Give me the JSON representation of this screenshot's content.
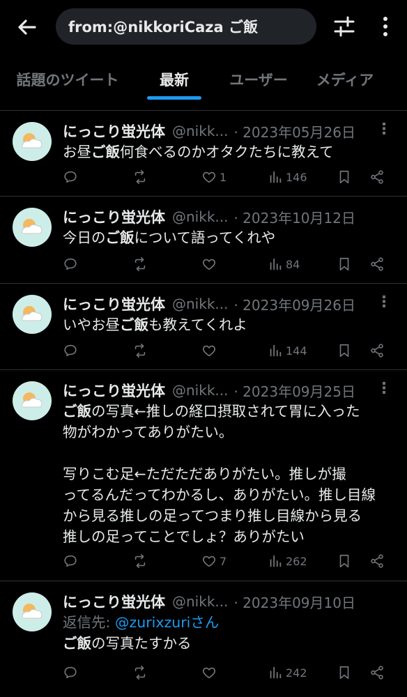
{
  "header": {
    "search_value": "from:@nikkoriCaza ご飯"
  },
  "tabs": [
    {
      "label": "話題のツイート",
      "active": false
    },
    {
      "label": "最新",
      "active": true
    },
    {
      "label": "ユーザー",
      "active": false
    },
    {
      "label": "メディア",
      "active": false
    }
  ],
  "tweets": [
    {
      "name": "にっこり蛍光体",
      "handle": "@nikk...",
      "date": "· 2023年05月26日",
      "body_pre": "お昼",
      "body_hl": "ご飯",
      "body_post": "何食べるのかオタクたちに教えて",
      "replies": "",
      "retweets": "",
      "likes": "1",
      "views": "146"
    },
    {
      "name": "にっこり蛍光体",
      "handle": "@nikk...",
      "date": "· 2023年10月12日",
      "body_pre": "今日の",
      "body_hl": "ご飯",
      "body_post": "について語ってくれや",
      "likes": "",
      "views": "84"
    },
    {
      "name": "にっこり蛍光体",
      "handle": "@nikk...",
      "date": "· 2023年09月26日",
      "body_pre": "いやお昼",
      "body_hl": "ご飯",
      "body_post": "も教えてくれよ",
      "likes": "",
      "views": "144"
    },
    {
      "name": "にっこり蛍光体",
      "handle": "@nikk...",
      "date": "· 2023年09月25日",
      "body_hl": "ご飯",
      "body_line1_post": "の写真←推しの経口摂取されて胃に入った",
      "body_line2": "物がわかってありがたい。",
      "body_line3": "写りこむ足←ただただありがたい。推しが撮",
      "body_line4": "ってるんだってわかるし、ありがたい。推し目線",
      "body_line5": "から見る推しの足ってつまり推し目線から見る",
      "body_line6": "推しの足ってことでしょ？ありがたい",
      "likes": "7",
      "views": "262"
    },
    {
      "name": "にっこり蛍光体",
      "handle": "@nikk...",
      "date": "· 2023年09月10日",
      "reply_label": "返信先: ",
      "reply_mention": "@zurixzuriさん",
      "body_hl": "ご飯",
      "body_post": "の写真たすかる",
      "likes": "",
      "views": "242"
    }
  ],
  "icons": {
    "back": "arrow-left-icon",
    "filter": "sliders-icon",
    "more": "vertical-dots-icon",
    "reply": "speech-bubble-icon",
    "retweet": "retweet-icon",
    "like": "heart-icon",
    "views": "bar-chart-icon",
    "bookmark": "bookmark-icon",
    "share": "share-icon"
  },
  "colors": {
    "background": "#000000",
    "accent": "#1d9bf0",
    "muted": "#71767b",
    "text": "#e7e9ea"
  }
}
